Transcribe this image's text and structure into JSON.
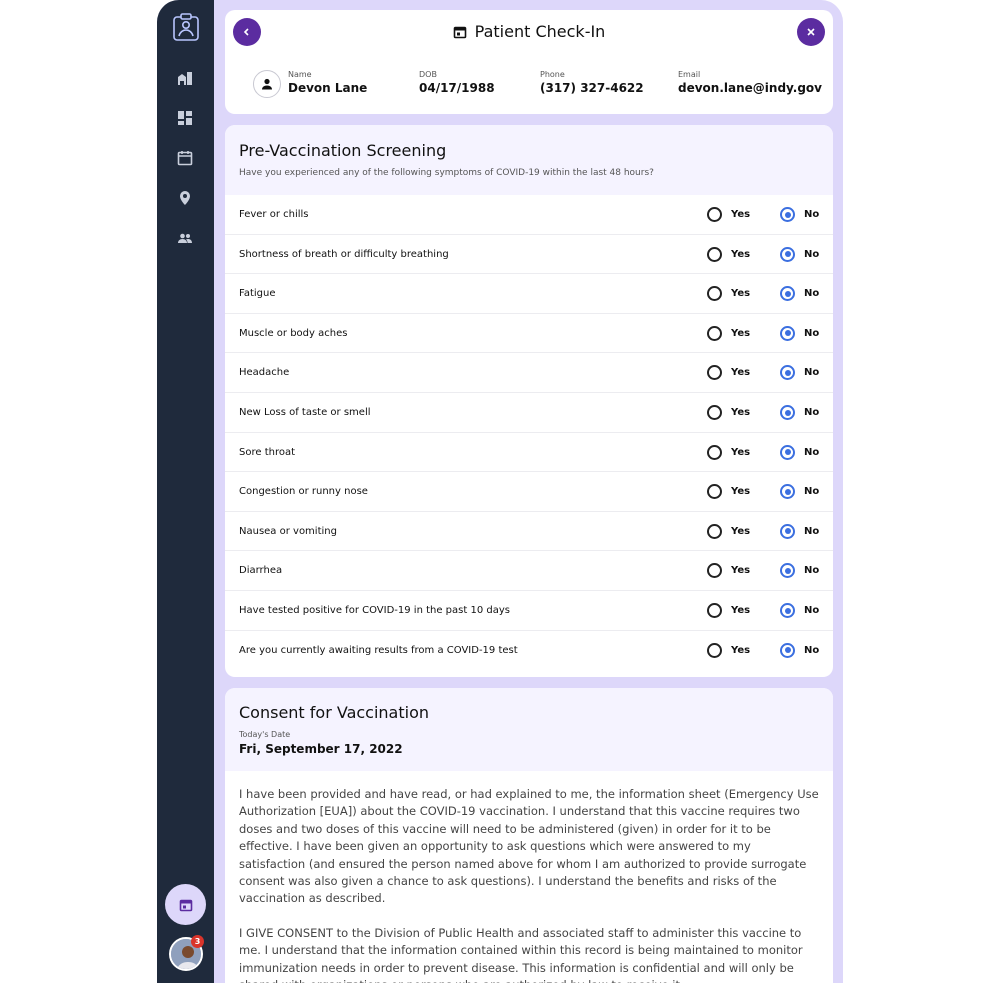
{
  "header": {
    "title": "Patient Check-In",
    "patient": {
      "name_label": "Name",
      "name": "Devon Lane",
      "dob_label": "DOB",
      "dob": "04/17/1988",
      "phone_label": "Phone",
      "phone": "(317) 327-4622",
      "email_label": "Email",
      "email": "devon.lane@indy.gov"
    }
  },
  "sidebar": {
    "items": [
      "buildings-icon",
      "dashboard-icon",
      "calendar-icon",
      "location-pin-icon",
      "people-icon"
    ],
    "notification_count": "3"
  },
  "screening": {
    "title": "Pre-Vaccination Screening",
    "subtitle": "Have you experienced any of the following symptoms of COVID-19 within the last 48 hours?",
    "yes_label": "Yes",
    "no_label": "No",
    "questions": [
      {
        "text": "Fever or chills",
        "answer": "No"
      },
      {
        "text": "Shortness of breath or difficulty breathing",
        "answer": "No"
      },
      {
        "text": "Fatigue",
        "answer": "No"
      },
      {
        "text": "Muscle or body aches",
        "answer": "No"
      },
      {
        "text": "Headache",
        "answer": "No"
      },
      {
        "text": "New Loss of taste or smell",
        "answer": "No"
      },
      {
        "text": "Sore throat",
        "answer": "No"
      },
      {
        "text": "Congestion or runny nose",
        "answer": "No"
      },
      {
        "text": "Nausea or vomiting",
        "answer": "No"
      },
      {
        "text": "Diarrhea",
        "answer": "No"
      },
      {
        "text": "Have tested positive for COVID-19 in the past 10 days",
        "answer": "No"
      },
      {
        "text": "Are you currently awaiting results from a COVID-19 test",
        "answer": "No"
      }
    ]
  },
  "consent": {
    "title": "Consent for Vaccination",
    "date_label": "Today's Date",
    "date": "Fri, September 17, 2022",
    "paragraphs": [
      "I have been provided and have read, or had explained to me, the information sheet (Emergency Use Authorization [EUA]) about the COVID-19 vaccination. I understand that this vaccine requires two doses and two doses of this vaccine will need to be administered (given) in order for it to be effective. I have been given an opportunity to ask questions which were answered to my satisfaction (and ensured the person named above for whom I am authorized to provide surrogate consent was also given a chance to ask questions). I understand the benefits and risks of the vaccination as described.",
      "I GIVE CONSENT to the Division of Public Health and associated staff to administer this vaccine to me. I understand that the information contained within this record is being maintained to monitor immunization needs in order to prevent disease. This information is confidential and will only be shared with organizations or persons who are authorized by law to receive it."
    ]
  },
  "colors": {
    "sidebar": "#1f2a3c",
    "accent": "#5b2ca0",
    "radio_selected": "#3b6fe0",
    "background": "#ddd7fa"
  }
}
